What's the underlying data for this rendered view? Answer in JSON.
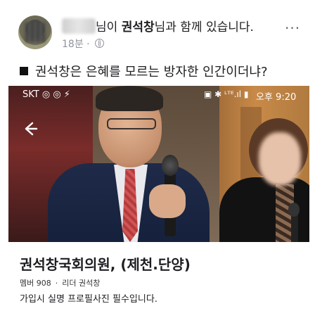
{
  "post": {
    "author_suffix": "님이",
    "tagged_name": "권석창",
    "with_text": "님과 함께 있습니다.",
    "time_ago": "18분",
    "meta_separator": "·",
    "more_glyph": "...",
    "text": "권석창은 은혜를 모르는 방자한 인간이더냐?"
  },
  "screenshot": {
    "carrier": "SKT",
    "carrier_icons": "◎ ◎ ⚡",
    "status_icons": "▣ ✱ ᴸᵀᴱ.ıl ▮",
    "time": "오후 9:20",
    "back_icon": "arrow-left-icon"
  },
  "group": {
    "title": "권석창국회의원, (제천.단양)",
    "members": "멤버 908",
    "separator": "·",
    "leader": "리더 권석창",
    "description": "가입시 실명 프로필사진 필수입니다."
  },
  "colors": {
    "meta_gray": "#90949c",
    "text": "#1c1e21"
  }
}
